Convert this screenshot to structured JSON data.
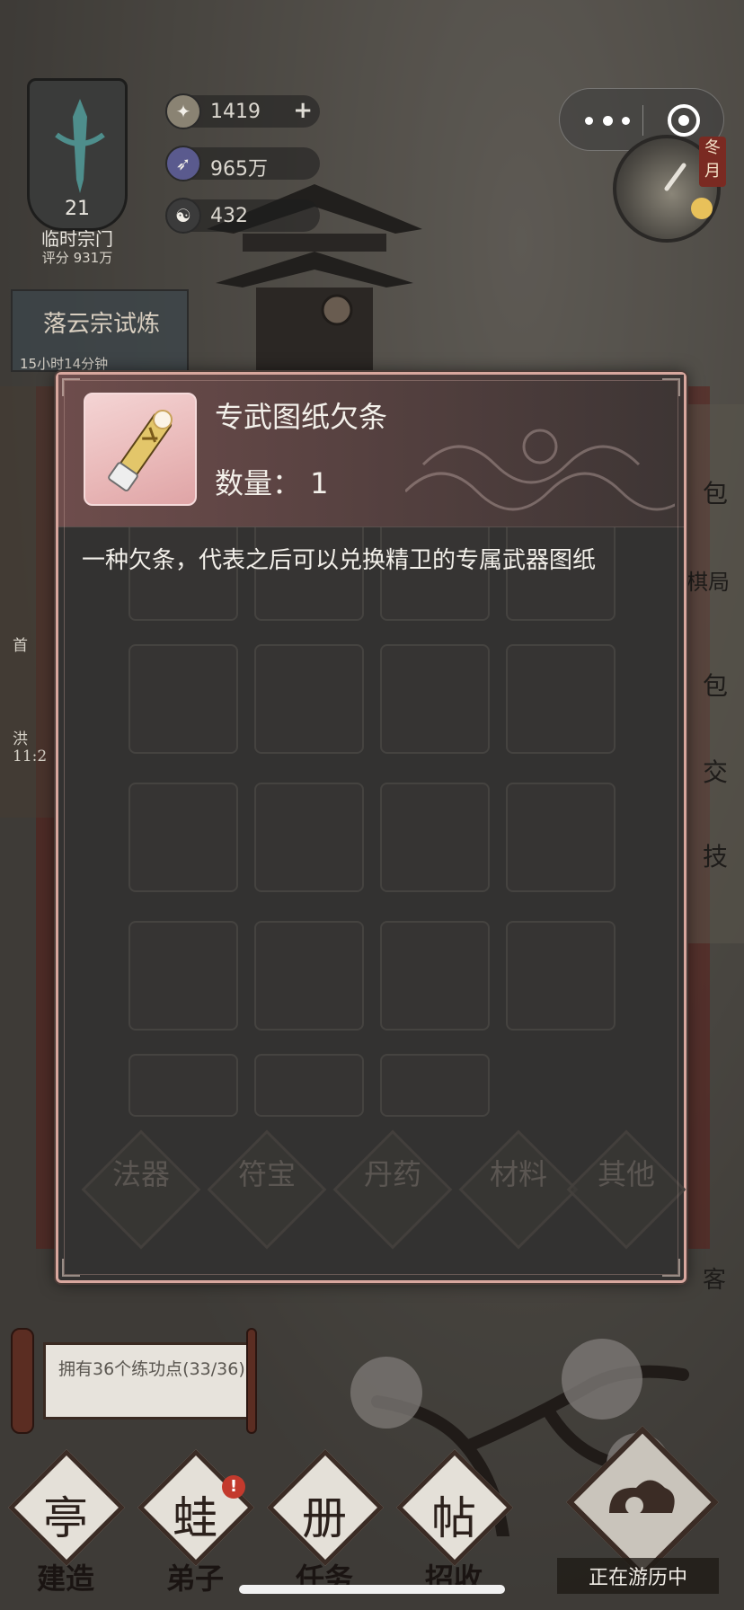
{
  "hud": {
    "sect_level": "21",
    "sect_name": "临时宗门",
    "sect_score": "评分 931万",
    "resources": [
      {
        "icon": "spirit-stone-icon",
        "value": "1419",
        "has_plus": true
      },
      {
        "icon": "feather-icon",
        "value": "965万",
        "has_plus": false
      },
      {
        "icon": "yin-yang-icon",
        "value": "432",
        "has_plus": false
      }
    ],
    "month_label": "冬月",
    "trial_title": "落云宗试炼",
    "trial_time": "15小时14分钟",
    "left_fragments": [
      "首",
      "洪",
      "11:2"
    ],
    "right_fragments": [
      "包",
      "棋局",
      "包",
      "交",
      "技",
      "客"
    ]
  },
  "modal": {
    "item_name": "专武图纸欠条",
    "quantity_text": "数量： 1",
    "description": "一种欠条，代表之后可以兑换精卫的专属武器图纸",
    "categories": [
      "法器",
      "符宝",
      "丹药",
      "材料",
      "其他"
    ]
  },
  "practice": {
    "text": "拥有36个练功点(33/36)"
  },
  "nav": {
    "items": [
      {
        "label": "建造",
        "glyph": "亭",
        "badge": ""
      },
      {
        "label": "弟子",
        "glyph": "蛙",
        "badge": "!"
      },
      {
        "label": "任务",
        "glyph": "册",
        "badge": ""
      },
      {
        "label": "招收",
        "glyph": "帖",
        "badge": ""
      }
    ],
    "travel_label": "正在游历中"
  },
  "colors": {
    "modal_bg": "#333231",
    "modal_border": "#d8a79e",
    "header_accent": "#6e4d4c",
    "badge_red": "#c33a2d"
  }
}
